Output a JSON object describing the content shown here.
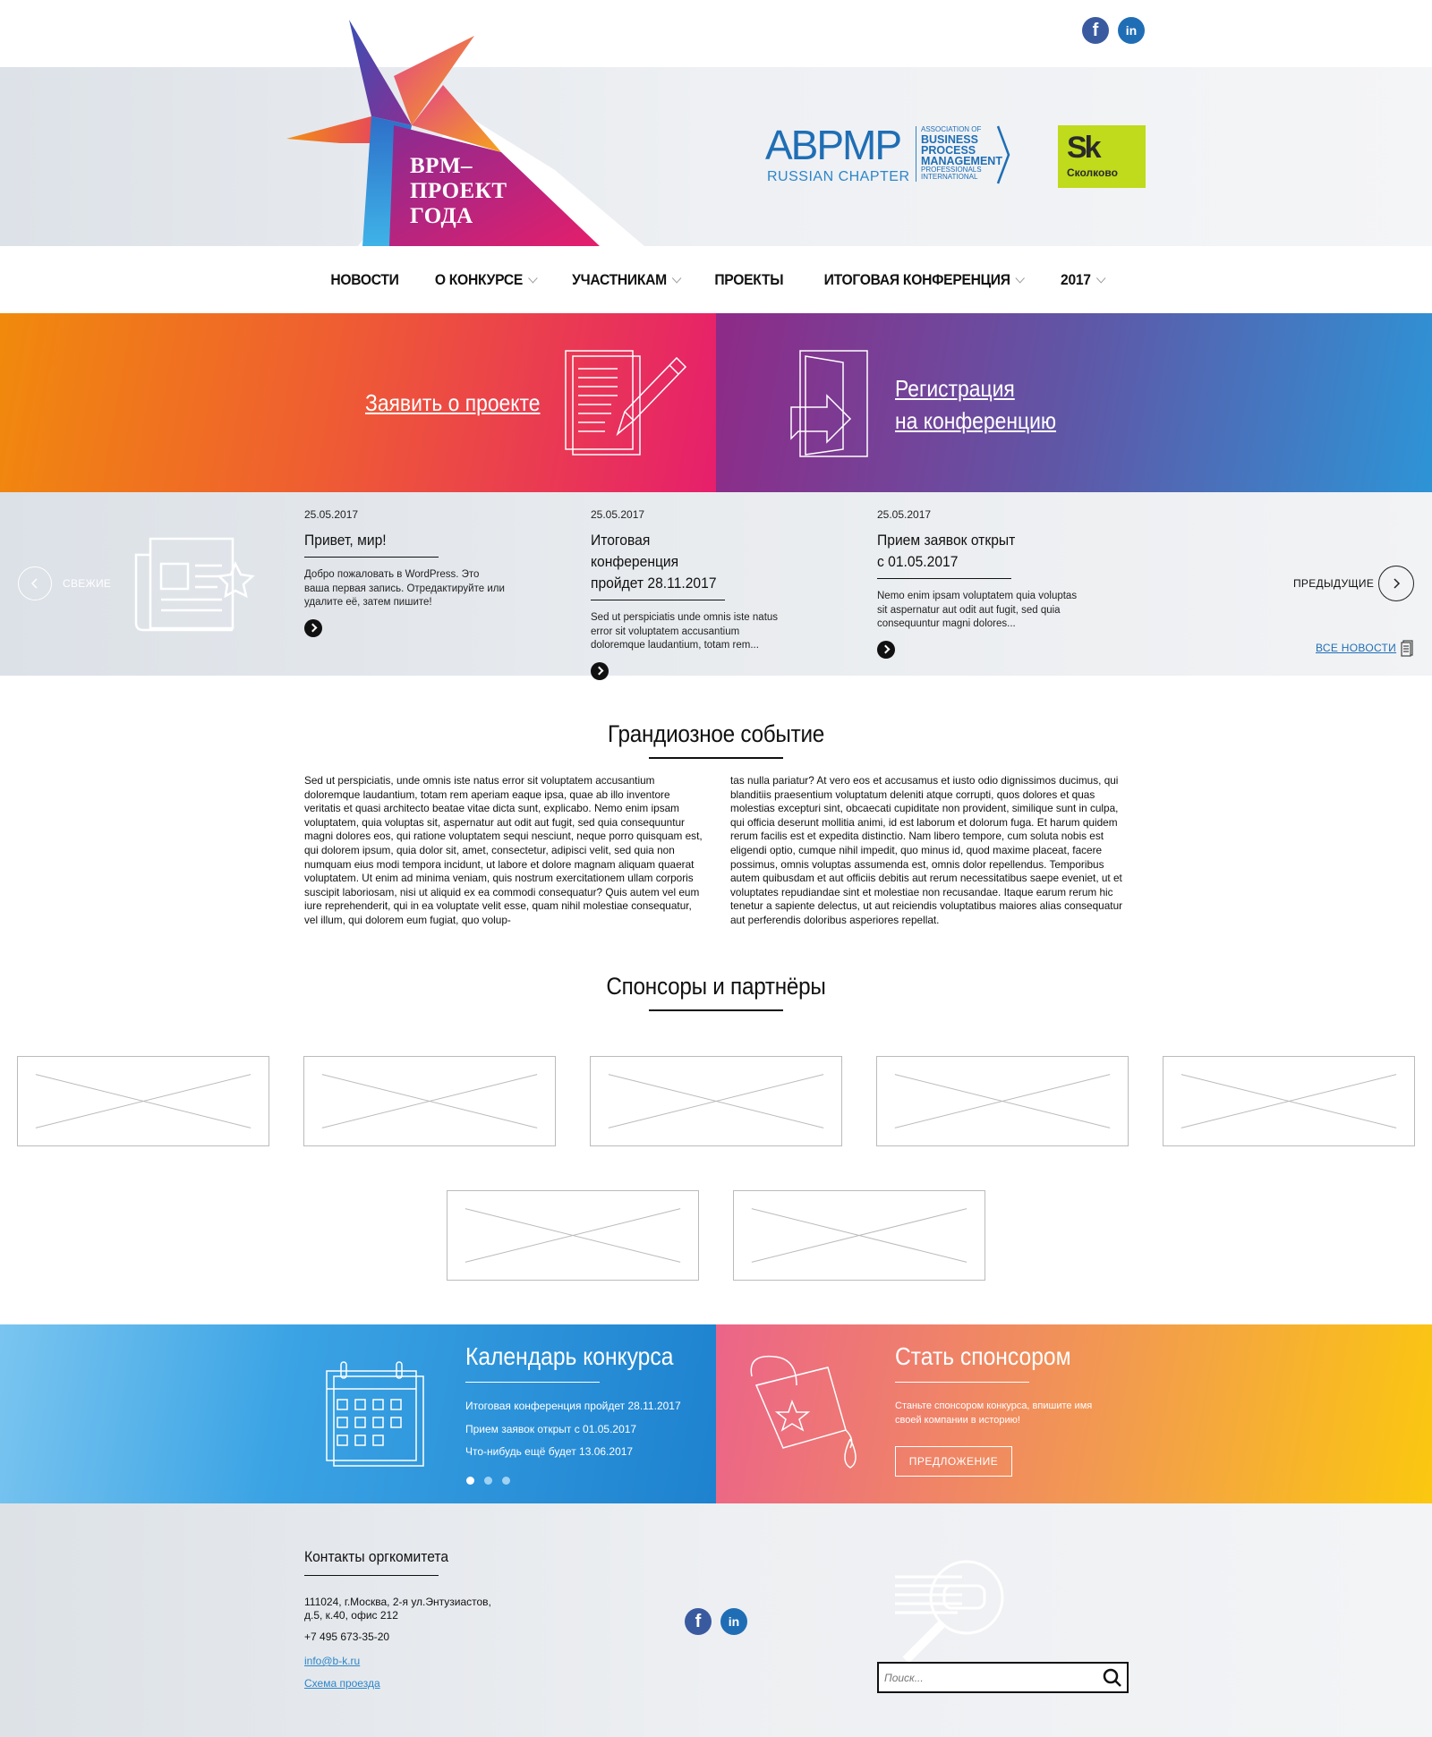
{
  "header": {
    "logo_text": [
      "BPM–",
      "ПРОЕКТ",
      "ГОДА"
    ],
    "social": {
      "facebook_glyph": "f",
      "linkedin_glyph": "in"
    },
    "abpmp": {
      "mark": "ABPMP",
      "chapter": "RUSSIAN CHAPTER",
      "small_top": "ASSOCIATION OF",
      "line1": "BUSINESS",
      "line2": "PROCESS",
      "line3": "MANAGEMENT",
      "small_bottom1": "PROFESSIONALS",
      "small_bottom2": "INTERNATIONAL"
    },
    "skolkovo": {
      "mark": "Sk",
      "name": "Сколково"
    }
  },
  "nav": {
    "items": [
      {
        "label": "НОВОСТИ",
        "has_dropdown": false
      },
      {
        "label": "О КОНКУРСЕ",
        "has_dropdown": true
      },
      {
        "label": "УЧАСТНИКАМ",
        "has_dropdown": true
      },
      {
        "label": "ПРОЕКТЫ",
        "has_dropdown": false
      },
      {
        "label": "ИТОГОВАЯ КОНФЕРЕНЦИЯ",
        "has_dropdown": true
      },
      {
        "label": "2017",
        "has_dropdown": true
      }
    ]
  },
  "banners": {
    "apply": "Заявить о проекте",
    "register_line1": "Регистрация",
    "register_line2": "на конференцию"
  },
  "news": {
    "prev_label": "СВЕЖИЕ",
    "next_label": "ПРЕДЫДУЩИЕ",
    "all_news": "ВСЕ НОВОСТИ",
    "items": [
      {
        "date": "25.05.2017",
        "title": "Привет, мир!",
        "excerpt": "Добро пожаловать в WordPress. Это ваша первая запись. Отредактируйте или удалите её, затем пишите!"
      },
      {
        "date": "25.05.2017",
        "title": "Итоговая конференция пройдет 28.11.2017",
        "excerpt": "Sed ut perspiciatis unde omnis iste natus error sit voluptatem accusantium doloremque laudantium, totam rem..."
      },
      {
        "date": "25.05.2017",
        "title": "Прием заявок открыт с 01.05.2017",
        "excerpt": "Nemo enim ipsam voluptatem quia voluptas sit aspernatur aut odit aut fugit, sed quia consequuntur magni dolores..."
      }
    ]
  },
  "event": {
    "title": "Грандиозное событие",
    "col1": "Sed ut perspiciatis, unde omnis iste natus error sit voluptatem accusantium doloremque laudantium, totam rem aperiam eaque ipsa, quae ab illo inventore veritatis et quasi architecto beatae vitae dicta sunt, explicabo. Nemo enim ipsam voluptatem, quia voluptas sit, aspernatur aut odit aut fugit, sed quia consequuntur magni dolores eos, qui ratione voluptatem sequi nesciunt, neque porro quisquam est, qui dolorem ipsum, quia dolor sit, amet, consectetur, adipisci velit, sed quia non numquam eius modi tempora incidunt, ut labore et dolore magnam aliquam quaerat voluptatem. Ut enim ad minima veniam, quis nostrum exercitationem ullam corporis suscipit laboriosam, nisi ut aliquid ex ea commodi consequatur? Quis autem vel eum iure reprehenderit, qui in ea voluptate velit esse, quam nihil molestiae consequatur, vel illum, qui dolorem eum fugiat, quo volup-",
    "col2": "tas nulla pariatur? At vero eos et accusamus et iusto odio dignissimos ducimus, qui blanditiis praesentium voluptatum deleniti atque corrupti, quos dolores et quas molestias excepturi sint, obcaecati cupiditate non provident, similique sunt in culpa, qui officia deserunt mollitia animi, id est laborum et dolorum fuga. Et harum quidem rerum facilis est et expedita distinctio. Nam libero tempore, cum soluta nobis est eligendi optio, cumque nihil impedit, quo minus id, quod maxime placeat, facere possimus, omnis voluptas assumenda est, omnis dolor repellendus. Temporibus autem quibusdam et aut officiis debitis aut rerum necessitatibus saepe eveniet, ut et voluptates repudiandae sint et molestiae non recusandae. Itaque earum rerum hic tenetur a sapiente delectus, ut aut reiciendis voluptatibus maiores alias consequatur aut perferendis doloribus asperiores repellat."
  },
  "sponsors": {
    "title": "Спонсоры и партнёры"
  },
  "calendar": {
    "title": "Календарь конкурса",
    "events": [
      "Итоговая конференция пройдет 28.11.2017",
      "Прием заявок открыт с 01.05.2017",
      "Что-нибудь ещё будет 13.06.2017"
    ]
  },
  "become_sponsor": {
    "title": "Стать спонсором",
    "text_line1": "Станьте спонсором конкурса, впишите имя",
    "text_line2": "своей компании в историю!",
    "button": "ПРЕДЛОЖЕНИЕ"
  },
  "footer": {
    "title": "Контакты оргкомитета",
    "address_line1": "111024, г.Москва, 2-я ул.Энтузиастов,",
    "address_line2": "д.5, к.40, офис 212",
    "phone": "+7 495 673-35-20",
    "email": "info@b-k.ru",
    "map_link": "Схема проезда",
    "search_placeholder": "Поиск..."
  },
  "colors": {
    "brand_blue": "#1f6eb5",
    "skolkovo_green": "#c0da1c",
    "facebook": "#3a5aa0",
    "linkedin": "#1f6eb5"
  },
  "icons": [
    "facebook-icon",
    "linkedin-icon",
    "document-pencil-icon",
    "door-arrow-icon",
    "newspaper-icon",
    "calendar-icon",
    "bucket-star-icon",
    "magnifier-icon",
    "search-icon"
  ]
}
